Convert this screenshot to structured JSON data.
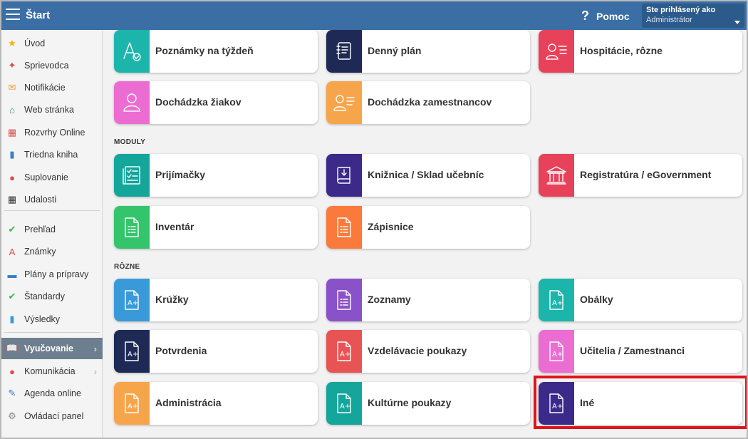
{
  "header": {
    "title": "Štart",
    "help_label": "Pomoc",
    "help_icon": "?",
    "user_label": "Ste prihlásený ako",
    "user_name": "Administrátor"
  },
  "sidebar": {
    "items": [
      {
        "label": "Úvod",
        "icon": "star-icon",
        "color": "#f4b400",
        "glyph": "★"
      },
      {
        "label": "Sprievodca",
        "icon": "magic-wand-icon",
        "color": "#e04848",
        "glyph": "✦"
      },
      {
        "label": "Notifikácie",
        "icon": "envelope-icon",
        "color": "#f0a030",
        "glyph": "✉"
      },
      {
        "label": "Web stránka",
        "icon": "home-icon",
        "color": "#2e8b57",
        "glyph": "⌂"
      },
      {
        "label": "Rozvrhy Online",
        "icon": "calendar-grid-icon",
        "color": "#d9534f",
        "glyph": "▦"
      },
      {
        "label": "Triedna kniha",
        "icon": "book-icon",
        "color": "#3a7dc9",
        "glyph": "▮"
      },
      {
        "label": "Suplovanie",
        "icon": "person-icon",
        "color": "#e04848",
        "glyph": "●"
      },
      {
        "label": "Udalosti",
        "icon": "calendar-icon",
        "color": "#333333",
        "glyph": "▦"
      },
      {
        "label": "Prehľad",
        "icon": "check-circle-icon",
        "color": "#3cb54a",
        "glyph": "✔"
      },
      {
        "label": "Známky",
        "icon": "grade-icon",
        "color": "#e04848",
        "glyph": "A"
      },
      {
        "label": "Plány a prípravy",
        "icon": "briefcase-icon",
        "color": "#3a7dc9",
        "glyph": "▬"
      },
      {
        "label": "Štandardy",
        "icon": "shield-icon",
        "color": "#3cb54a",
        "glyph": "✔"
      },
      {
        "label": "Výsledky",
        "icon": "bar-chart-icon",
        "color": "#3a9ad9",
        "glyph": "▮"
      },
      {
        "label": "Vyučovanie",
        "icon": "open-book-icon",
        "color": "#ffffff",
        "glyph": "📖"
      },
      {
        "label": "Komunikácia",
        "icon": "chat-bubbles-icon",
        "color": "#e04848",
        "glyph": "●"
      },
      {
        "label": "Agenda online",
        "icon": "pen-icon",
        "color": "#3a7dc9",
        "glyph": "✎"
      },
      {
        "label": "Ovládací panel",
        "icon": "gear-icon",
        "color": "#888888",
        "glyph": "⚙"
      }
    ]
  },
  "sections": {
    "moduly": "MODULY",
    "rozne": "RÔZNE"
  },
  "tiles": {
    "row1": [
      {
        "label": "Poznámky na týždeň",
        "icon": "notes-check-icon",
        "color": "#1bb5ab"
      },
      {
        "label": "Denný plán",
        "icon": "planner-icon",
        "color": "#1e2a55"
      },
      {
        "label": "Hospitácie, rôzne",
        "icon": "presenter-icon",
        "color": "#e8415a"
      }
    ],
    "row2": [
      {
        "label": "Dochádzka žiakov",
        "icon": "student-icon",
        "color": "#ec6dd2"
      },
      {
        "label": "Dochádzka zamestnancov",
        "icon": "employee-icon",
        "color": "#f7a54a"
      }
    ],
    "moduly_row1": [
      {
        "label": "Prijímačky",
        "icon": "admission-form-icon",
        "color": "#14a59b"
      },
      {
        "label": "Knižnica / Sklad učebníc",
        "icon": "library-book-icon",
        "color": "#3b2a8a"
      },
      {
        "label": "Registratúra / eGovernment",
        "icon": "government-building-icon",
        "color": "#e8415a"
      }
    ],
    "moduly_row2": [
      {
        "label": "Inventár",
        "icon": "inventory-doc-icon",
        "color": "#34c46c"
      },
      {
        "label": "Zápisnice",
        "icon": "minutes-doc-icon",
        "color": "#fa7a3c"
      }
    ],
    "rozne_row1": [
      {
        "label": "Krúžky",
        "icon": "grade-doc-icon",
        "color": "#3a9ad9"
      },
      {
        "label": "Zoznamy",
        "icon": "list-doc-icon",
        "color": "#8a52c8"
      },
      {
        "label": "Obálky",
        "icon": "grade-doc-icon",
        "color": "#1bb5ab"
      }
    ],
    "rozne_row2": [
      {
        "label": "Potvrdenia",
        "icon": "grade-doc-icon",
        "color": "#1e2a55"
      },
      {
        "label": "Vzdelávacie poukazy",
        "icon": "grade-doc-icon",
        "color": "#e85454"
      },
      {
        "label": "Učitelia / Zamestnanci",
        "icon": "grade-doc-icon",
        "color": "#ec6dd2"
      }
    ],
    "rozne_row3": [
      {
        "label": "Administrácia",
        "icon": "grade-doc-icon",
        "color": "#f7a54a"
      },
      {
        "label": "Kultúrne poukazy",
        "icon": "grade-doc-icon",
        "color": "#14a59b"
      },
      {
        "label": "Iné",
        "icon": "grade-doc-icon",
        "color": "#3b2a8a"
      }
    ]
  }
}
